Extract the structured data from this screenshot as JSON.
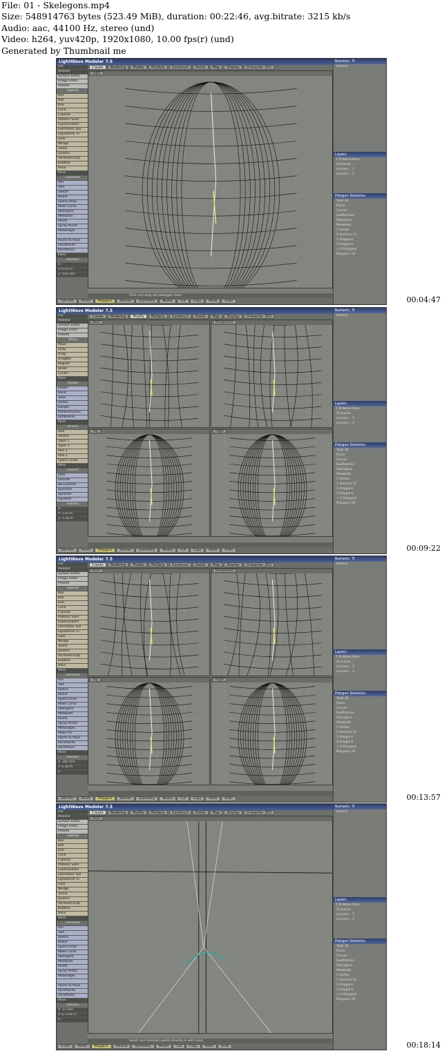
{
  "info": {
    "file": "File: 01 - Skelegons.mp4",
    "size": "Size: 548914763 bytes (523.49 MiB), duration: 00:22:46, avg.bitrate: 3215 kb/s",
    "audio": "Audio: aac, 44100 Hz, stereo (und)",
    "video": "Video: h264, yuv420p, 1920x1080, 10.00 fps(r) (und)",
    "generated": "Generated by Thumbnail me"
  },
  "app": {
    "title": "LightWave Modeler 7.5",
    "tabs": [
      "Create",
      "Modeling",
      "Modify",
      "Multiply",
      "Construct",
      "Detail",
      "Map",
      "Display",
      "Character_001"
    ],
    "file_label": "File",
    "modeler_label": "Modeler",
    "surface_editor": "Surface Editor",
    "image_editor": "Image Editor",
    "presets": "Presets",
    "numeric": "Numeric: Tr",
    "actions": "Actions",
    "layers": "Layers",
    "polygon_stats": "Polygon Statistics",
    "layer_rows": [
      "Characte...",
      "(unnam...",
      "(unnam..."
    ],
    "layer_nums": [
      "",
      "1",
      "2"
    ],
    "layers_header": [
      "F",
      "B",
      "Name",
      "Num"
    ],
    "poly_rows": [
      "Total",
      "Faces",
      "Curves",
      "SubPatches",
      "Skelegons",
      "Metaballs",
      "1 Vertex",
      "2 Vertices",
      "3 Polygons",
      "4 Polygons",
      "> 4 Polygons",
      "Polygons"
    ],
    "poly_nums": [
      "39",
      "",
      "",
      "",
      "",
      "",
      "",
      "11",
      "",
      "",
      "",
      "19"
    ],
    "bottom_buttons": [
      "Sel",
      "Points",
      "Polygons",
      "Volume",
      "Symmetry",
      "Modes",
      "Cut",
      "Copy",
      "Paste",
      "Undo"
    ],
    "bottom_right": [
      "W",
      "T",
      "M",
      "(none)"
    ]
  },
  "frames": [
    {
      "timestamp": "00:04:47",
      "mode": "create",
      "status": "Click and drag out skelegon chain",
      "position": {
        "label": "Position",
        "x": "X:",
        "y": "Y: 0.43 m",
        "z": "Z: 915 mm"
      },
      "grid": "100 mm",
      "sel": "Sel:",
      "sel_count": "1",
      "viewports": [
        {
          "name": "Right"
        }
      ],
      "left_sections": [
        {
          "header": "Objects",
          "items": [
            "Box",
            "Ball",
            "Disc",
            "Cone",
            "Capsule",
            "Platonic Solid",
            "SuperQuadric",
            "Gemstone Tool",
            "Equilateral Tri",
            "Gear",
            "Wedge",
            "Toroid",
            "Quadric",
            "ParametricObj",
            "Bubbles",
            "Helix",
            "More"
          ]
        },
        {
          "header": "Elements",
          "items": [
            "Pen",
            "Text",
            "Sketch",
            "Bezier",
            "Spline Draw",
            "Make Curve",
            "Skelegons",
            "Metaballs",
            "Points",
            "Spray Points",
            "Metaedges",
            "",
            "Points to Polys",
            "RandPoints",
            "RandPacks",
            "More"
          ]
        }
      ]
    },
    {
      "timestamp": "00:09:22",
      "mode": "modify",
      "status": "",
      "position": {
        "label": "Position",
        "x": "X:",
        "y": "Y: 5.54 m",
        "z": "Z: 1.44 m"
      },
      "grid": "500 mm",
      "sel": "Sel:",
      "sel_count": "",
      "viewports": [
        {
          "name": "Back"
        },
        {
          "name": "Perspective"
        },
        {
          "name": "Top"
        },
        {
          "name": "Right"
        }
      ],
      "left_sections": [
        {
          "header": "Move",
          "items": [
            "Move",
            "Snap",
            "Drag",
            "DragNet",
            "Magnet",
            "Shear",
            "Center",
            "More"
          ]
        },
        {
          "header": "Rotate",
          "items": [
            "Rotate",
            "Bend",
            "Twist",
            "Vortex",
            "Dangle",
            "RotateAnyAxis",
            "RotateHPB",
            "More"
          ]
        },
        {
          "header": "Stretch",
          "items": [
            "Size",
            "Stretch",
            "Taper 1",
            "Taper 2",
            "Pole 1",
            "Pole 2",
            "Spline Guide",
            "More"
          ]
        },
        {
          "header": "Deform",
          "items": [
            "Jitter",
            "Smooth",
            "BGConform",
            "Quantize",
            "Spherize",
            "Squeeze"
          ]
        }
      ]
    },
    {
      "timestamp": "00:13:57",
      "mode": "create",
      "status": "",
      "position": {
        "label": "Position",
        "x": "X: 340 mm",
        "y": "Y: 6.38 m",
        "z": "Z:"
      },
      "grid": "200 mm",
      "sel": "Sel:",
      "sel_count": "",
      "viewports": [
        {
          "name": "Back"
        },
        {
          "name": "Perspective"
        },
        {
          "name": "Top"
        },
        {
          "name": "Right"
        }
      ],
      "left_sections": [
        {
          "header": "Objects",
          "items": [
            "Box",
            "Ball",
            "Disc",
            "Cone",
            "Capsule",
            "Platonic Solid",
            "SuperQuadric",
            "Gemstone Tool",
            "Equilateral Tri",
            "Gear",
            "Wedge",
            "Toroid",
            "Quadric",
            "ParametricObj",
            "Bubbles",
            "Helix",
            "More"
          ]
        },
        {
          "header": "Elements",
          "items": [
            "Pen",
            "Text",
            "Sketch",
            "Bezier",
            "Spline Draw",
            "Make Curve",
            "Skelegons",
            "Metaballs",
            "Points",
            "Spray Points",
            "Metaedges",
            "Make Pol",
            "Points to Polys",
            "RandPoints",
            "RandPacks",
            "More"
          ]
        }
      ]
    },
    {
      "timestamp": "00:18:14",
      "mode": "create",
      "status": "Select and deselect points directly or with lasso",
      "position": {
        "label": "Position",
        "x": "X: 11 mm",
        "y": "Y: 6.7104 m",
        "z": "Z:"
      },
      "grid": "5 mm",
      "sel": "Sel:",
      "sel_count": "0",
      "viewports": [
        {
          "name": "Back"
        }
      ],
      "left_sections": [
        {
          "header": "Objects",
          "items": [
            "Box",
            "Ball",
            "Disc",
            "Cone",
            "Capsule",
            "Platonic Solid",
            "SuperQuadric",
            "Gemstone Tool",
            "Equilateral Tri",
            "Gear",
            "Wedge",
            "Toroid",
            "Quadric",
            "ParametricObj",
            "Bubbles",
            "Helix",
            "More"
          ]
        },
        {
          "header": "Elements",
          "items": [
            "Pen",
            "Text",
            "Sketch",
            "Bezier",
            "Spline Draw",
            "Make Curve",
            "Skelegons",
            "Metaballs",
            "Points",
            "Spray Points",
            "Metaedges",
            "",
            "Points to Polys",
            "RandPoints",
            "RandPacks",
            "More"
          ]
        }
      ]
    }
  ]
}
